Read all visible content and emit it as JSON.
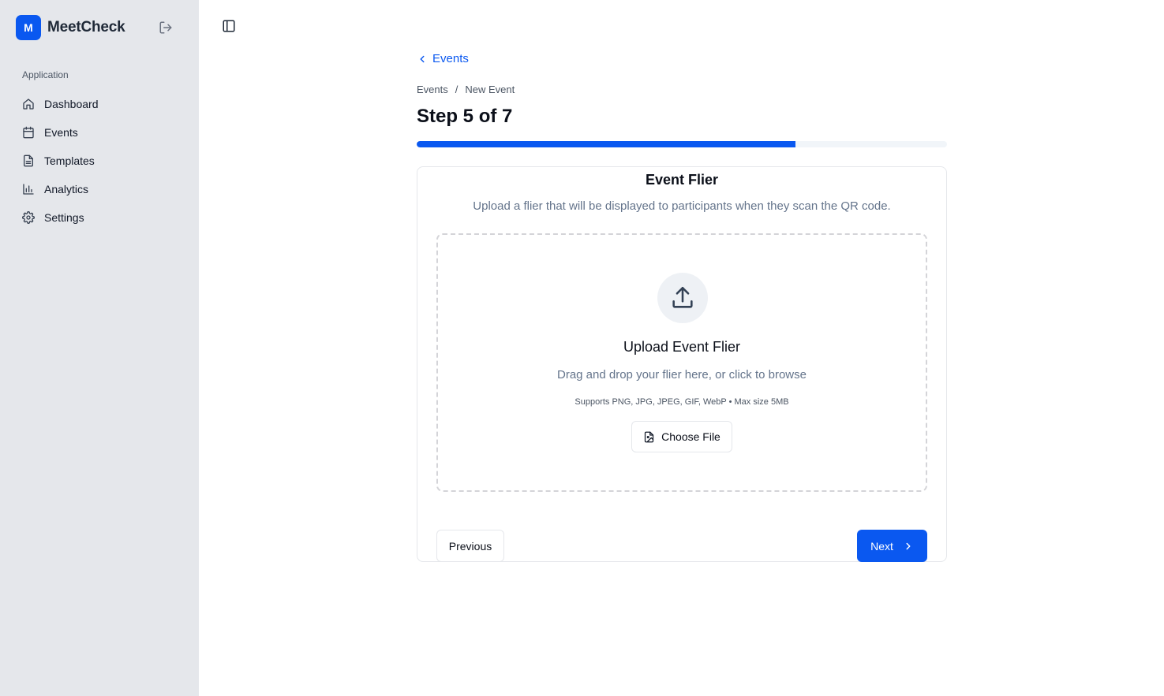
{
  "app": {
    "logo_letter": "M",
    "name": "MeetCheck"
  },
  "sidebar": {
    "section_label": "Application",
    "items": [
      {
        "label": "Dashboard",
        "icon": "home-icon"
      },
      {
        "label": "Events",
        "icon": "calendar-icon"
      },
      {
        "label": "Templates",
        "icon": "document-icon"
      },
      {
        "label": "Analytics",
        "icon": "bar-chart-icon"
      },
      {
        "label": "Settings",
        "icon": "gear-icon"
      }
    ]
  },
  "header": {
    "back_label": "Events",
    "breadcrumb": [
      "Events",
      "New Event"
    ],
    "breadcrumb_separator": "/",
    "step_title": "Step 5 of 7",
    "progress": {
      "current": 5,
      "total": 7
    }
  },
  "card": {
    "title": "Event Flier",
    "description": "Upload a flier that will be displayed to participants when they scan the QR code.",
    "dropzone": {
      "title": "Upload Event Flier",
      "description": "Drag and drop your flier here, or click to browse",
      "formats": "Supports PNG, JPG, JPEG, GIF, WebP • Max size 5MB",
      "button_label": "Choose File"
    },
    "previous_label": "Previous",
    "next_label": "Next"
  },
  "colors": {
    "accent": "#0a58f0",
    "sidebar_bg": "#e5e7eb",
    "muted_text": "#64748b",
    "progress_track": "#f1f5f9"
  }
}
